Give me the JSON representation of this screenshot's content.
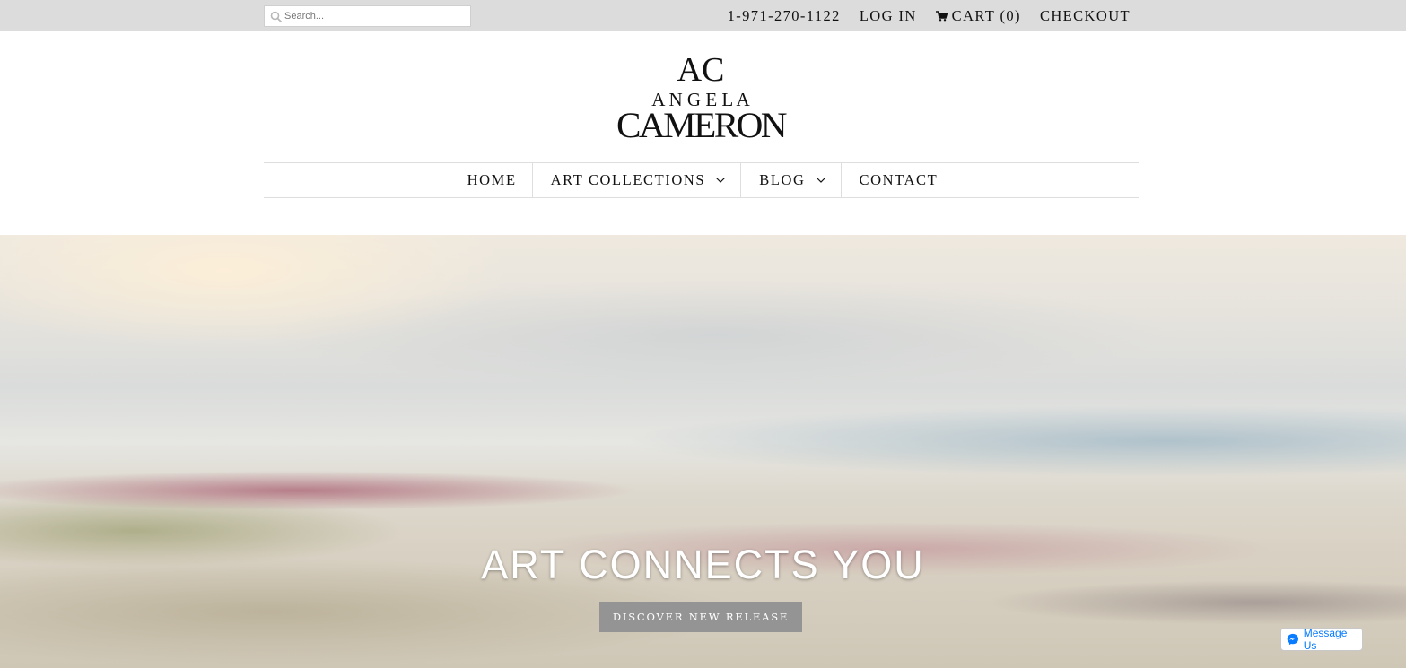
{
  "topbar": {
    "search_placeholder": "Search...",
    "phone": "1-971-270-1122",
    "login": "LOG IN",
    "cart": "CART (0)",
    "checkout": "CHECKOUT"
  },
  "logo": {
    "monogram": "AC",
    "line1": "A N G E L A",
    "line2": "CAMERON"
  },
  "nav": {
    "items": [
      {
        "label": "HOME",
        "has_dropdown": false
      },
      {
        "label": "ART COLLECTIONS",
        "has_dropdown": true
      },
      {
        "label": "BLOG",
        "has_dropdown": true
      },
      {
        "label": "CONTACT",
        "has_dropdown": false
      }
    ]
  },
  "hero": {
    "title": "ART CONNECTS YOU",
    "button": "DISCOVER NEW RELEASE"
  },
  "messenger": {
    "label": "Message Us",
    "color": "#0a7cff"
  },
  "icons": [
    "search-icon",
    "cart-icon",
    "chevron-down-icon",
    "messenger-icon"
  ]
}
